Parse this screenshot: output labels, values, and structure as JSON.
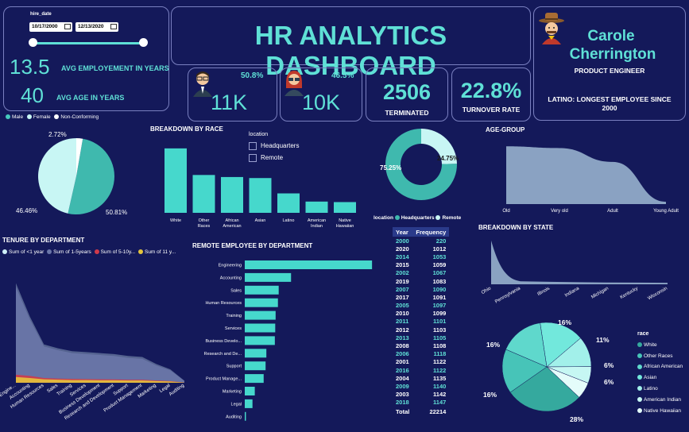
{
  "filters": {
    "hire_date_label": "hire_date",
    "start_date": "10/17/2000",
    "end_date": "12/13/2020",
    "location_label": "location",
    "location_options": [
      "Headquarters",
      "Remote"
    ]
  },
  "kpis": {
    "avg_employment_value": "13.5",
    "avg_employment_label": "AVG EMPLOYEMENT IN YEARS",
    "avg_age_value": "40",
    "avg_age_label": "AVG AGE IN YEARS",
    "male_pct": "50.8%",
    "male_count": "11K",
    "female_pct": "46.5%",
    "female_count": "10K",
    "terminated_value": "2506",
    "terminated_label": "TERMINATED",
    "turnover_value": "22.8%",
    "turnover_label": "TURNOVER RATE"
  },
  "header": {
    "title": "HR ANALYTICS DASHBOARD"
  },
  "profile": {
    "first_name": "Carole",
    "last_name": "Cherrington",
    "role": "PRODUCT ENGINEER",
    "note": "LATINO: LONGEST EMPLOYEE SINCE 2000"
  },
  "colors": {
    "background": "#14195a",
    "accent": "#5fe0d6",
    "panel_border": "#7a80c0"
  },
  "chart_data": [
    {
      "id": "gender",
      "type": "pie",
      "legend": [
        "Male",
        "Female",
        "Non-Conforming"
      ],
      "labels": [
        "Male",
        "Female",
        "Non-Conforming"
      ],
      "values": [
        50.81,
        46.46,
        2.72
      ],
      "value_labels": [
        "50.81%",
        "46.46%",
        "2.72%"
      ],
      "colors": [
        "#3fb9ae",
        "#c8f6f4",
        "#ffffff"
      ],
      "legend_colors": [
        "#46c9bd",
        "#c8f6f4",
        "#ffffff"
      ]
    },
    {
      "id": "race",
      "type": "bar",
      "title": "BREAKDOWN BY RACE",
      "categories": [
        "White",
        "Other Races",
        "African American",
        "Asian",
        "Latino",
        "American Indian",
        "Native Hawaiian"
      ],
      "tick_labels": [
        [
          "White"
        ],
        [
          "Other",
          "Races"
        ],
        [
          "African",
          "American"
        ],
        [
          "Asian"
        ],
        [
          "Latino"
        ],
        [
          "American",
          "Indian"
        ],
        [
          "Native",
          "Hawaiian"
        ]
      ],
      "values": [
        6300,
        3700,
        3500,
        3400,
        1900,
        1100,
        1050
      ],
      "ylim": [
        0,
        6600
      ]
    },
    {
      "id": "location",
      "type": "pie",
      "legend_title": "location",
      "labels": [
        "Headquarters",
        "Remote"
      ],
      "values": [
        75.25,
        24.75
      ],
      "value_labels": [
        "75.25%",
        "24.75%"
      ],
      "colors": [
        "#3fb9ae",
        "#c8f6f4"
      ]
    },
    {
      "id": "age_group",
      "type": "area",
      "title": "AGE-GROUP",
      "categories": [
        "Old",
        "Very old",
        "Adult",
        "Young Adult"
      ],
      "values": [
        100,
        97,
        73,
        4
      ],
      "ylim": [
        0,
        110
      ]
    },
    {
      "id": "tenure",
      "type": "area",
      "title": "TENURE BY DEPARTMENT",
      "categories": [
        "Engineering",
        "Accounting",
        "Human Resources",
        "Sales",
        "Training",
        "Services",
        "Business Development",
        "Research and Development",
        "Support",
        "Product Management",
        "Marketing",
        "Legal",
        "Auditing"
      ],
      "tick_labels": [
        "Engine...",
        "Accounting",
        "Human Resources",
        "Sales",
        "Training",
        "Services",
        "Business Development",
        "Research and Development",
        "Support",
        "Product Management",
        "Marketing",
        "Legal",
        "Auditing"
      ],
      "legend": [
        "Sum of <1 year",
        "Sum of 1-5years",
        "Sum of 5-10y...",
        "Sum of 11 y..."
      ],
      "series": [
        {
          "name": "Sum of 11 y...",
          "color": "#e4c43c",
          "values": [
            300,
            250,
            180,
            160,
            140,
            140,
            130,
            130,
            120,
            120,
            90,
            70,
            10
          ]
        },
        {
          "name": "Sum of 5-10y...",
          "color": "#d03a4a",
          "values": [
            420,
            360,
            250,
            220,
            200,
            190,
            180,
            175,
            160,
            160,
            120,
            90,
            15
          ]
        },
        {
          "name": "Sum of 1-5years",
          "color": "#6a76a8",
          "values": [
            5000,
            3300,
            1900,
            1700,
            1550,
            1500,
            1450,
            1400,
            1300,
            1250,
            900,
            650,
            100
          ]
        },
        {
          "name": "Sum of <1 year",
          "color": "#cfeff7",
          "values": [
            5200,
            3450,
            2000,
            1800,
            1650,
            1600,
            1550,
            1500,
            1400,
            1350,
            980,
            700,
            110
          ]
        }
      ],
      "ylim": [
        0,
        5600
      ]
    },
    {
      "id": "remote",
      "type": "bar",
      "title": "REMOTE EMPLOYEE BY DEPARTMENT",
      "categories": [
        "Engineering",
        "Accounting",
        "Sales",
        "Human Resources",
        "Training",
        "Services",
        "Business Develo...",
        "Research and De...",
        "Support",
        "Product Manage...",
        "Marketing",
        "Legal",
        "Auditing"
      ],
      "values": [
        1650,
        600,
        440,
        430,
        400,
        395,
        390,
        280,
        270,
        245,
        130,
        100,
        15
      ],
      "xlim": [
        0,
        1700
      ]
    },
    {
      "id": "hires_by_year",
      "type": "table",
      "columns": [
        "Year",
        "Frequency"
      ],
      "rows": [
        [
          "2000",
          "220"
        ],
        [
          "2020",
          "1012"
        ],
        [
          "2014",
          "1053"
        ],
        [
          "2015",
          "1059"
        ],
        [
          "2002",
          "1067"
        ],
        [
          "2019",
          "1083"
        ],
        [
          "2007",
          "1090"
        ],
        [
          "2017",
          "1091"
        ],
        [
          "2005",
          "1097"
        ],
        [
          "2010",
          "1099"
        ],
        [
          "2011",
          "1101"
        ],
        [
          "2012",
          "1103"
        ],
        [
          "2013",
          "1105"
        ],
        [
          "2008",
          "1108"
        ],
        [
          "2006",
          "1118"
        ],
        [
          "2001",
          "1122"
        ],
        [
          "2016",
          "1122"
        ],
        [
          "2004",
          "1135"
        ],
        [
          "2009",
          "1140"
        ],
        [
          "2003",
          "1142"
        ],
        [
          "2018",
          "1147"
        ]
      ],
      "total": [
        "Total",
        "22214"
      ]
    },
    {
      "id": "state",
      "type": "area",
      "title": "BREAKDOWN BY STATE",
      "categories": [
        "Ohio",
        "Pennsylvania",
        "Illinois",
        "Indiana",
        "Michigan",
        "Kentucky",
        "Wisconsin"
      ],
      "values": [
        16000,
        1100,
        900,
        750,
        650,
        600,
        550
      ],
      "ylim": [
        0,
        18000
      ]
    },
    {
      "id": "race_share",
      "type": "pie",
      "legend_title": "race",
      "legend": [
        "White",
        "Other Races",
        "African American",
        "Asian",
        "Latino",
        "American Indian",
        "Native Hawaiian"
      ],
      "labels": [
        "White",
        "Other Races",
        "African American",
        "Asian",
        "Latino",
        "American Indian",
        "Native Hawaiian"
      ],
      "values": [
        28,
        16,
        16,
        16,
        11,
        6,
        6
      ],
      "value_labels": [
        "28%",
        "16%",
        "16%",
        "16%",
        "11%",
        "6%",
        "6%"
      ],
      "colors": [
        "#35a99e",
        "#47c4b8",
        "#5fd8cc",
        "#72e8dc",
        "#a2f0ea",
        "#c6f7f3",
        "#e4fcfa"
      ]
    }
  ]
}
